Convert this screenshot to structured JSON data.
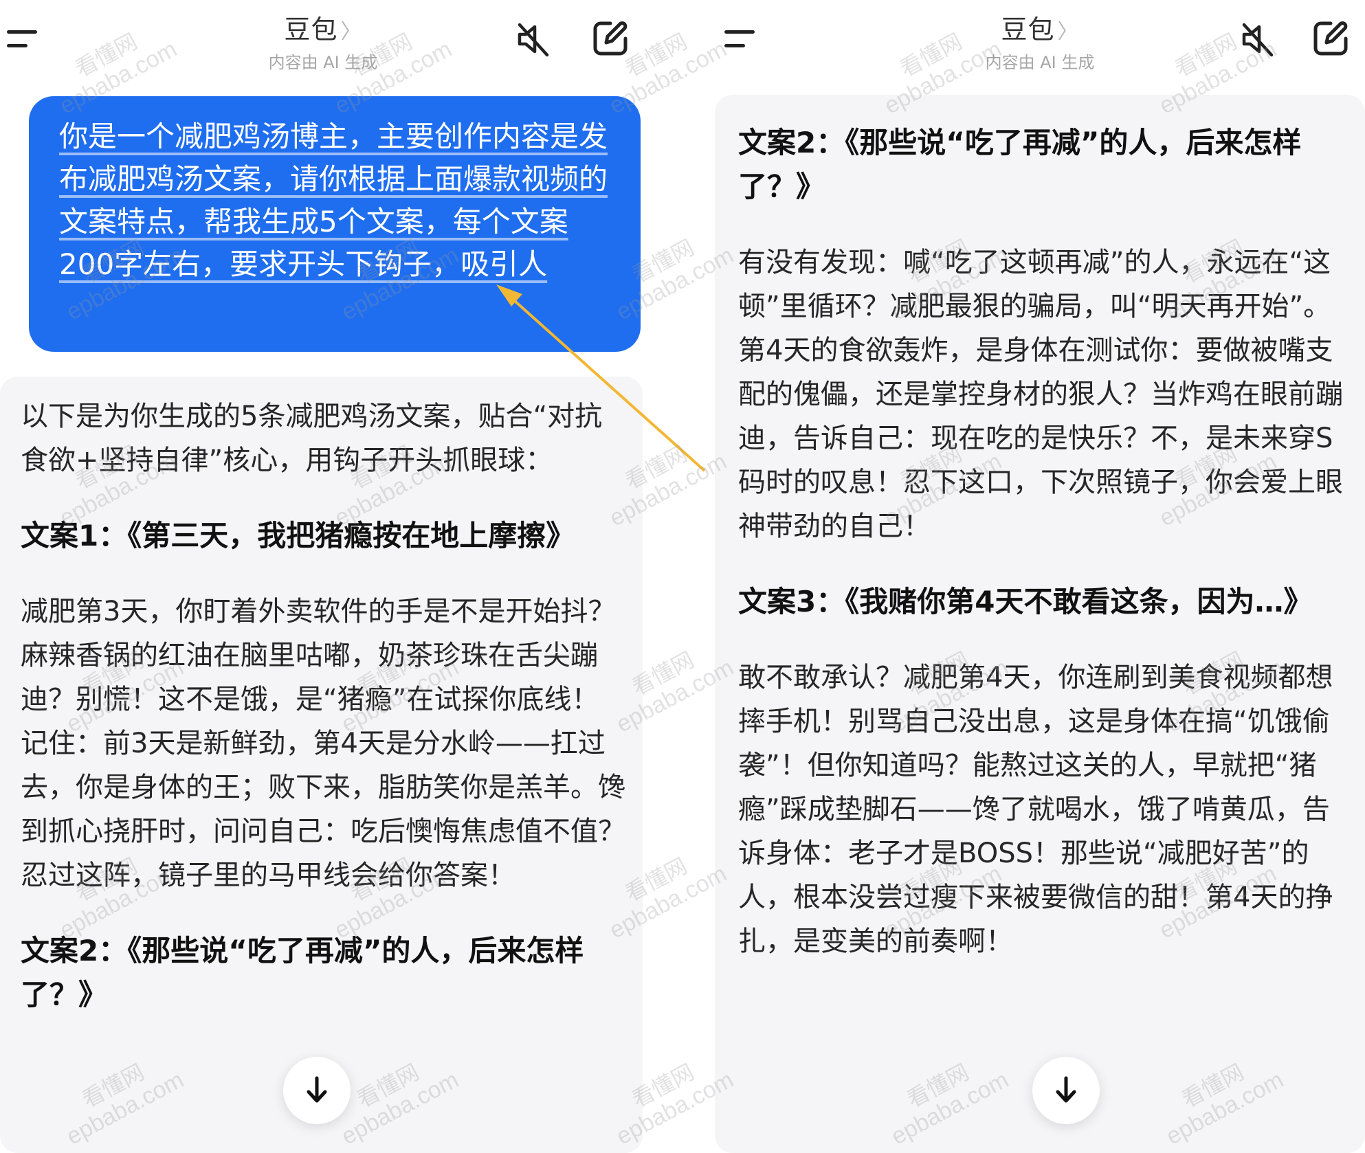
{
  "left": {
    "header": {
      "title": "豆包",
      "chevron": "〉",
      "subtitle": "内容由 AI 生成"
    },
    "user_message": "你是一个减肥鸡汤博主，主要创作内容是发布减肥鸡汤文案，请你根据上面爆款视频的文案特点，帮我生成5个文案，每个文案200字左右，要求开头下钩子，吸引人",
    "reply": {
      "intro": "以下是为你生成的5条减肥鸡汤文案，贴合“对抗食欲+坚持自律”核心，用钩子开头抓眼球：",
      "h1": "文案1：《第三天，我把猪瘾按在地上摩擦》",
      "p1": "减肥第3天，你盯着外卖软件的手是不是开始抖？麻辣香锅的红油在脑里咕嘟，奶茶珍珠在舌尖蹦迪？别慌！这不是饿，是“猪瘾”在试探你底线！记住：前3天是新鲜劲，第4天是分水岭——扛过去，你是身体的王；败下来，脂肪笑你是羔羊。馋到抓心挠肝时，问问自己：吃后懊悔焦虑值不值？忍过这阵，镜子里的马甲线会给你答案！",
      "h2": "文案2：《那些说“吃了再减”的人，后来怎样了？》"
    }
  },
  "right": {
    "header": {
      "title": "豆包",
      "chevron": "〉",
      "subtitle": "内容由 AI 生成"
    },
    "reply": {
      "h2": "文案2：《那些说“吃了再减”的人，后来怎样了？》",
      "p2": "有没有发现：喊“吃了这顿再减”的人，永远在“这顿”里循环？减肥最狠的骗局，叫“明天再开始”。第4天的食欲轰炸，是身体在测试你：要做被嘴支配的傀儡，还是掌控身材的狠人？当炸鸡在眼前蹦迪，告诉自己：现在吃的是快乐？不，是未来穿S码时的叹息！忍下这口，下次照镜子，你会爱上眼神带劲的自己！",
      "h3": "文案3：《我赌你第4天不敢看这条，因为…》",
      "p3": "敢不敢承认？减肥第4天，你连刷到美食视频都想摔手机！别骂自己没出息，这是身体在搞“饥饿偷袭”！但你知道吗？能熬过这关的人，早就把“猪瘾”踩成垫脚石——馋了就喝水，饿了啃黄瓜，告诉身体：老子才是BOSS！那些说“减肥好苦”的人，根本没尝过瘦下来被要微信的甜！第4天的挣扎，是变美的前奏啊！"
    }
  },
  "watermark": {
    "line1": "看懂网",
    "line2": "epbaba.com"
  },
  "icons": [
    "menu-icon",
    "mute-icon",
    "edit-icon",
    "scroll-down-icon"
  ],
  "colors": {
    "bubble": "#1f6ef0",
    "card": "#f5f5f7",
    "arrow": "#f2b733"
  }
}
